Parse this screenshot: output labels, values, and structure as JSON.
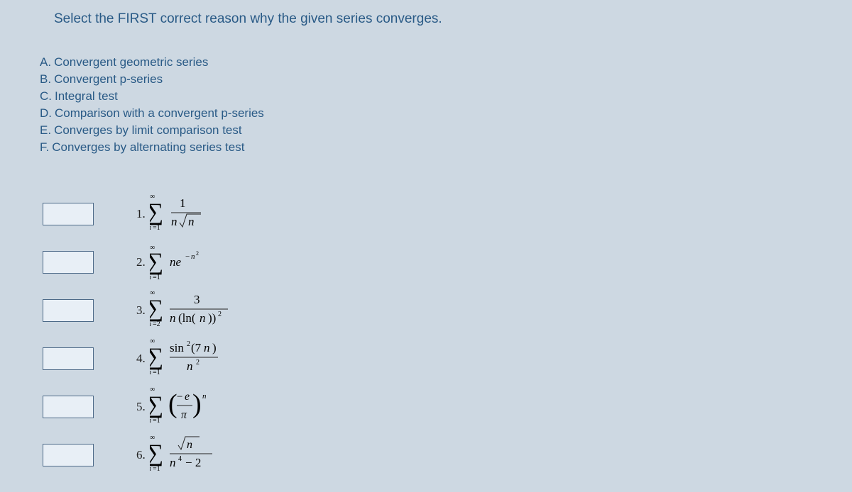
{
  "question": "Select the FIRST correct reason why the given series converges.",
  "options": [
    {
      "letter": "A.",
      "text": "Convergent geometric series"
    },
    {
      "letter": "B.",
      "text": "Convergent p-series"
    },
    {
      "letter": "C.",
      "text": "Integral test"
    },
    {
      "letter": "D.",
      "text": "Comparison with a convergent p-series"
    },
    {
      "letter": "E.",
      "text": "Converges by limit comparison test"
    },
    {
      "letter": "F.",
      "text": "Converges by alternating series test"
    }
  ],
  "problems": [
    {
      "number": "1.",
      "expr": "sum_{n=1}^{∞} 1 / (n√n)",
      "startIndex": "n=1"
    },
    {
      "number": "2.",
      "expr": "sum_{n=1}^{∞} n e^{-n²}",
      "startIndex": "n=1"
    },
    {
      "number": "3.",
      "expr": "sum_{n=2}^{∞} 3 / (n (ln n)²)",
      "startIndex": "n=2"
    },
    {
      "number": "4.",
      "expr": "sum_{n=1}^{∞} sin²(7n) / n²",
      "startIndex": "n=1"
    },
    {
      "number": "5.",
      "expr": "sum_{n=1}^{∞} (-e/π)^n",
      "startIndex": "n=1"
    },
    {
      "number": "6.",
      "expr": "sum_{n=1}^{∞} √n / (n⁴ - 2)",
      "startIndex": "n=1"
    }
  ]
}
